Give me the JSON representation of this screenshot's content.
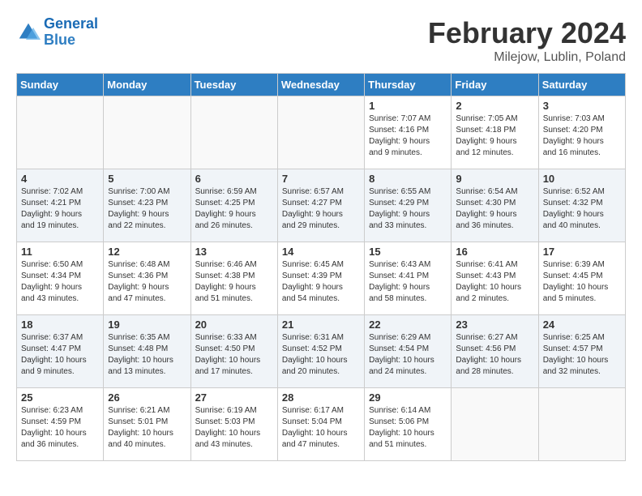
{
  "logo": {
    "line1": "General",
    "line2": "Blue"
  },
  "title": "February 2024",
  "location": "Milejow, Lublin, Poland",
  "headers": [
    "Sunday",
    "Monday",
    "Tuesday",
    "Wednesday",
    "Thursday",
    "Friday",
    "Saturday"
  ],
  "weeks": [
    [
      {
        "day": "",
        "info": ""
      },
      {
        "day": "",
        "info": ""
      },
      {
        "day": "",
        "info": ""
      },
      {
        "day": "",
        "info": ""
      },
      {
        "day": "1",
        "info": "Sunrise: 7:07 AM\nSunset: 4:16 PM\nDaylight: 9 hours\nand 9 minutes."
      },
      {
        "day": "2",
        "info": "Sunrise: 7:05 AM\nSunset: 4:18 PM\nDaylight: 9 hours\nand 12 minutes."
      },
      {
        "day": "3",
        "info": "Sunrise: 7:03 AM\nSunset: 4:20 PM\nDaylight: 9 hours\nand 16 minutes."
      }
    ],
    [
      {
        "day": "4",
        "info": "Sunrise: 7:02 AM\nSunset: 4:21 PM\nDaylight: 9 hours\nand 19 minutes."
      },
      {
        "day": "5",
        "info": "Sunrise: 7:00 AM\nSunset: 4:23 PM\nDaylight: 9 hours\nand 22 minutes."
      },
      {
        "day": "6",
        "info": "Sunrise: 6:59 AM\nSunset: 4:25 PM\nDaylight: 9 hours\nand 26 minutes."
      },
      {
        "day": "7",
        "info": "Sunrise: 6:57 AM\nSunset: 4:27 PM\nDaylight: 9 hours\nand 29 minutes."
      },
      {
        "day": "8",
        "info": "Sunrise: 6:55 AM\nSunset: 4:29 PM\nDaylight: 9 hours\nand 33 minutes."
      },
      {
        "day": "9",
        "info": "Sunrise: 6:54 AM\nSunset: 4:30 PM\nDaylight: 9 hours\nand 36 minutes."
      },
      {
        "day": "10",
        "info": "Sunrise: 6:52 AM\nSunset: 4:32 PM\nDaylight: 9 hours\nand 40 minutes."
      }
    ],
    [
      {
        "day": "11",
        "info": "Sunrise: 6:50 AM\nSunset: 4:34 PM\nDaylight: 9 hours\nand 43 minutes."
      },
      {
        "day": "12",
        "info": "Sunrise: 6:48 AM\nSunset: 4:36 PM\nDaylight: 9 hours\nand 47 minutes."
      },
      {
        "day": "13",
        "info": "Sunrise: 6:46 AM\nSunset: 4:38 PM\nDaylight: 9 hours\nand 51 minutes."
      },
      {
        "day": "14",
        "info": "Sunrise: 6:45 AM\nSunset: 4:39 PM\nDaylight: 9 hours\nand 54 minutes."
      },
      {
        "day": "15",
        "info": "Sunrise: 6:43 AM\nSunset: 4:41 PM\nDaylight: 9 hours\nand 58 minutes."
      },
      {
        "day": "16",
        "info": "Sunrise: 6:41 AM\nSunset: 4:43 PM\nDaylight: 10 hours\nand 2 minutes."
      },
      {
        "day": "17",
        "info": "Sunrise: 6:39 AM\nSunset: 4:45 PM\nDaylight: 10 hours\nand 5 minutes."
      }
    ],
    [
      {
        "day": "18",
        "info": "Sunrise: 6:37 AM\nSunset: 4:47 PM\nDaylight: 10 hours\nand 9 minutes."
      },
      {
        "day": "19",
        "info": "Sunrise: 6:35 AM\nSunset: 4:48 PM\nDaylight: 10 hours\nand 13 minutes."
      },
      {
        "day": "20",
        "info": "Sunrise: 6:33 AM\nSunset: 4:50 PM\nDaylight: 10 hours\nand 17 minutes."
      },
      {
        "day": "21",
        "info": "Sunrise: 6:31 AM\nSunset: 4:52 PM\nDaylight: 10 hours\nand 20 minutes."
      },
      {
        "day": "22",
        "info": "Sunrise: 6:29 AM\nSunset: 4:54 PM\nDaylight: 10 hours\nand 24 minutes."
      },
      {
        "day": "23",
        "info": "Sunrise: 6:27 AM\nSunset: 4:56 PM\nDaylight: 10 hours\nand 28 minutes."
      },
      {
        "day": "24",
        "info": "Sunrise: 6:25 AM\nSunset: 4:57 PM\nDaylight: 10 hours\nand 32 minutes."
      }
    ],
    [
      {
        "day": "25",
        "info": "Sunrise: 6:23 AM\nSunset: 4:59 PM\nDaylight: 10 hours\nand 36 minutes."
      },
      {
        "day": "26",
        "info": "Sunrise: 6:21 AM\nSunset: 5:01 PM\nDaylight: 10 hours\nand 40 minutes."
      },
      {
        "day": "27",
        "info": "Sunrise: 6:19 AM\nSunset: 5:03 PM\nDaylight: 10 hours\nand 43 minutes."
      },
      {
        "day": "28",
        "info": "Sunrise: 6:17 AM\nSunset: 5:04 PM\nDaylight: 10 hours\nand 47 minutes."
      },
      {
        "day": "29",
        "info": "Sunrise: 6:14 AM\nSunset: 5:06 PM\nDaylight: 10 hours\nand 51 minutes."
      },
      {
        "day": "",
        "info": ""
      },
      {
        "day": "",
        "info": ""
      }
    ]
  ]
}
